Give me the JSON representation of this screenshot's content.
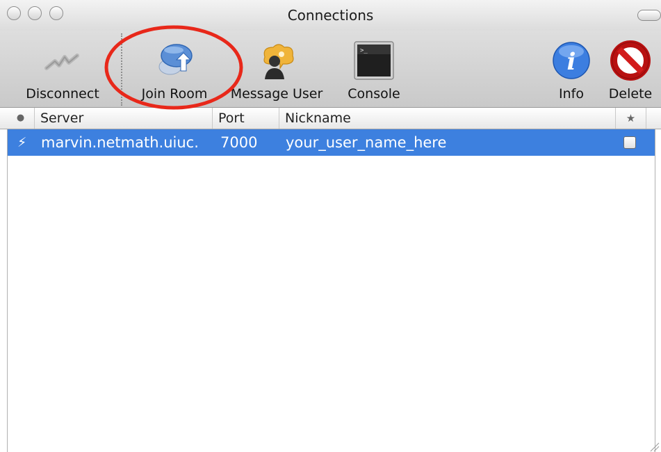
{
  "window": {
    "title": "Connections"
  },
  "toolbar": {
    "items": [
      {
        "label": "Disconnect",
        "icon": "disconnect-icon"
      },
      {
        "label": "Join Room",
        "icon": "join-room-icon"
      },
      {
        "label": "Message User",
        "icon": "message-user-icon"
      },
      {
        "label": "Console",
        "icon": "console-icon"
      },
      {
        "label": "Info",
        "icon": "info-icon"
      },
      {
        "label": "Delete",
        "icon": "delete-icon"
      }
    ]
  },
  "table": {
    "columns": [
      "●",
      "Server",
      "Port",
      "Nickname",
      "★"
    ],
    "rows": [
      {
        "status": "⚡",
        "server": "marvin.netmath.uiuc.",
        "port": "7000",
        "nickname": "your_user_name_here",
        "favorite_checked": false,
        "selected": true
      }
    ]
  },
  "annotation": {
    "highlight": "Join Room",
    "color": "#e8281a"
  },
  "colors": {
    "selection": "#3d80df",
    "toolbar": "#d3d3d3",
    "annotation": "#e8281a"
  }
}
